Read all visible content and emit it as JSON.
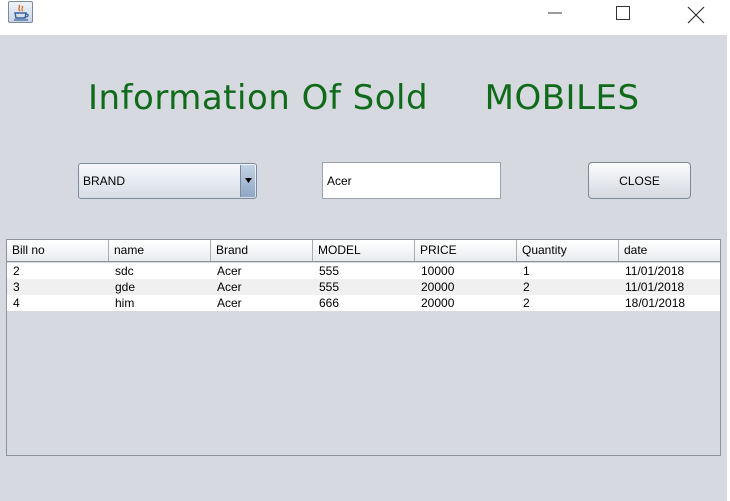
{
  "window": {
    "app_icon": "java-cup-icon",
    "controls": [
      "minimize-icon",
      "maximize-icon",
      "close-icon"
    ]
  },
  "heading": {
    "part1": "Information Of Sold",
    "part2": "MOBILES"
  },
  "filter": {
    "combo_value": "BRAND",
    "search_value": "Acer",
    "close_label": "CLOSE"
  },
  "table": {
    "columns": [
      "Bill no",
      "name",
      "Brand",
      "MODEL",
      "PRICE",
      "Quantity",
      "date"
    ],
    "rows": [
      [
        "2",
        "sdc",
        "Acer",
        "555",
        "10000",
        "1",
        "11/01/2018"
      ],
      [
        "3",
        "gde",
        "Acer",
        "555",
        "20000",
        "2",
        "11/01/2018"
      ],
      [
        "4",
        "him",
        "Acer",
        "666",
        "20000",
        "2",
        "18/01/2018"
      ]
    ]
  }
}
